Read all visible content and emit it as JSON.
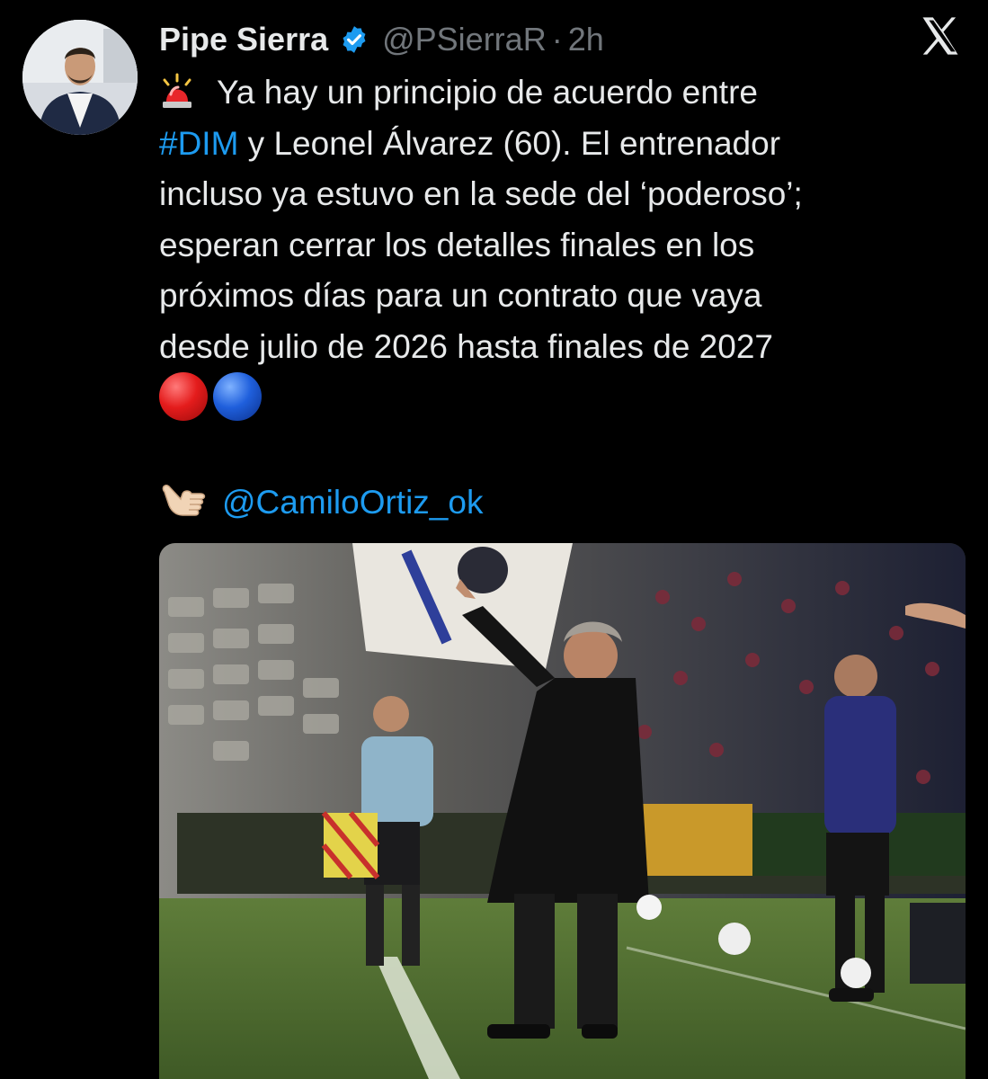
{
  "author": {
    "display_name": "Pipe Sierra",
    "handle": "@PSierraR",
    "separator": "·",
    "timestamp": "2h",
    "verified_icon": "verified-badge-icon",
    "verified_color": "#1d9bf0"
  },
  "platform": {
    "logo_icon": "x-logo-icon"
  },
  "tweet": {
    "line1": "Ya hay un principio de acuerdo entre",
    "hashtag": "#DIM",
    "line2_rest": " y Leonel Álvarez (60). El entrenador",
    "line3": "incluso ya estuvo en la sede del ‘poderoso’;",
    "line4": "esperan cerrar los detalles finales en los",
    "line5": "próximos días para un contrato que vaya",
    "line6": "desde julio de 2026 hasta finales de 2027",
    "credit_mention": "@CamiloOrtiz_ok",
    "emojis": {
      "lead": "police-siren-icon",
      "colors": [
        "red-circle-icon",
        "blue-circle-icon"
      ],
      "credit": "call-me-hand-icon"
    }
  },
  "media": {
    "type": "photo",
    "icon": "photo-attachment"
  },
  "colors": {
    "background": "#000000",
    "text": "#e7e9ea",
    "secondary": "#71767b",
    "link": "#1d9bf0"
  }
}
